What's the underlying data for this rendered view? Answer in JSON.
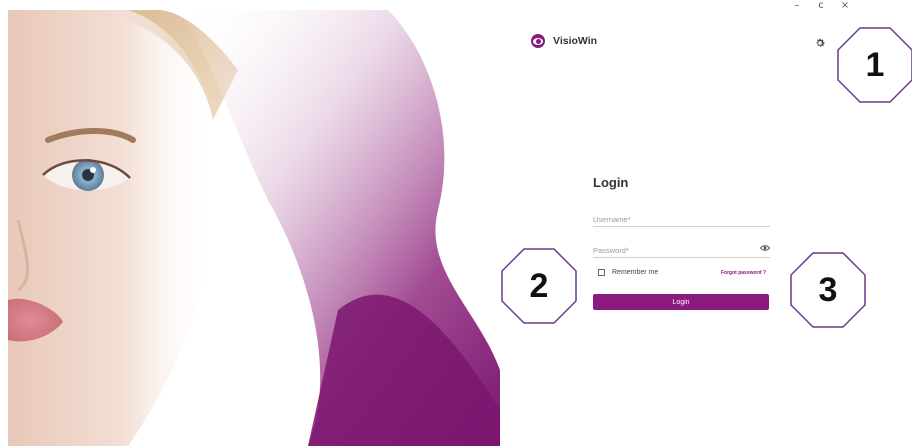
{
  "window_controls": {
    "minimize": "–",
    "restore": "c",
    "close": "×"
  },
  "brand": {
    "name": "VisioWin",
    "logo_icon": "eye-icon",
    "accent_color": "#8a1a7e"
  },
  "settings_icon": "gear-icon",
  "login": {
    "title": "Login",
    "username_placeholder": "Username*",
    "password_placeholder": "Password*",
    "show_password_icon": "eye-icon",
    "remember_me_label": "Remember me",
    "remember_me_checked": false,
    "forgot_password_label": "Forgot password ?",
    "submit_label": "Login"
  },
  "callouts": [
    "1",
    "2",
    "3"
  ]
}
